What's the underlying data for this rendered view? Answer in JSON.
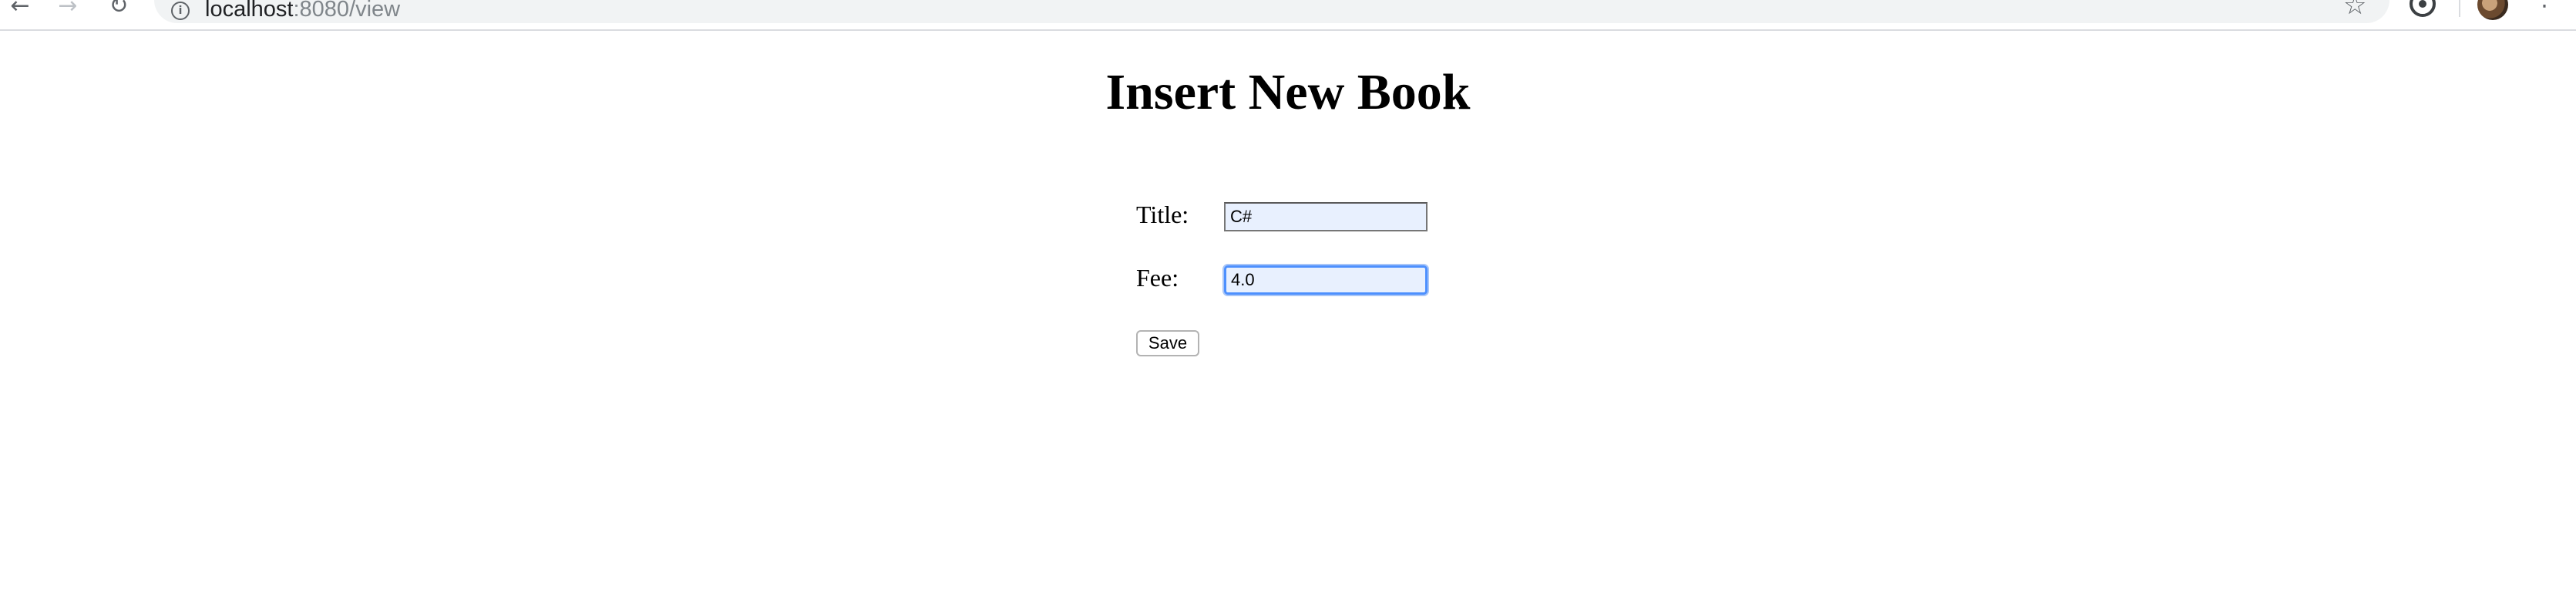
{
  "browser": {
    "url_host": "localhost",
    "url_path": ":8080/view"
  },
  "page": {
    "title": "Insert New Book"
  },
  "form": {
    "title_label": "Title:",
    "title_value": "C#",
    "fee_label": "Fee:",
    "fee_value": "4.0",
    "save_label": "Save"
  }
}
